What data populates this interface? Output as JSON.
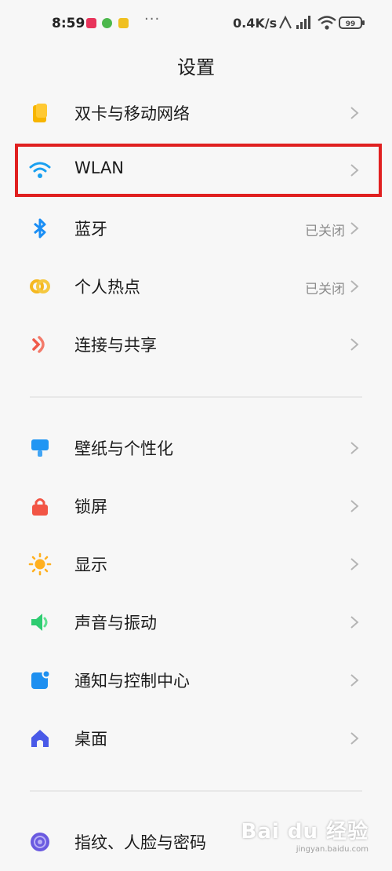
{
  "status_bar": {
    "time": "8:59",
    "dots": "···",
    "speed": "0.4K/s",
    "battery": "99"
  },
  "page": {
    "title": "设置"
  },
  "rows": [
    {
      "label": "双卡与移动网络",
      "value": "",
      "icon": "sim-card-icon",
      "color": "#f7b500"
    },
    {
      "label": "WLAN",
      "value": "",
      "icon": "wifi-icon",
      "color": "#1aa0f0"
    },
    {
      "label": "蓝牙",
      "value": "已关闭",
      "icon": "bluetooth-icon",
      "color": "#1a8ef5"
    },
    {
      "label": "个人热点",
      "value": "已关闭",
      "icon": "hotspot-icon",
      "color": "#f5b820"
    },
    {
      "label": "连接与共享",
      "value": "",
      "icon": "share-icon",
      "color": "#f05a4a"
    },
    {
      "label": "壁纸与个性化",
      "value": "",
      "icon": "wallpaper-icon",
      "color": "#2196f3"
    },
    {
      "label": "锁屏",
      "value": "",
      "icon": "lock-icon",
      "color": "#f25545"
    },
    {
      "label": "显示",
      "value": "",
      "icon": "sun-icon",
      "color": "#ffb020"
    },
    {
      "label": "声音与振动",
      "value": "",
      "icon": "speaker-icon",
      "color": "#2ecc71"
    },
    {
      "label": "通知与控制中心",
      "value": "",
      "icon": "notification-icon",
      "color": "#1e90f0"
    },
    {
      "label": "桌面",
      "value": "",
      "icon": "home-icon",
      "color": "#4a5ae8"
    },
    {
      "label": "指纹、人脸与密码",
      "value": "",
      "icon": "fingerprint-icon",
      "color": "#6a5ae0"
    }
  ],
  "watermark": {
    "brand": "Bai du 经验",
    "url": "jingyan.baidu.com"
  }
}
